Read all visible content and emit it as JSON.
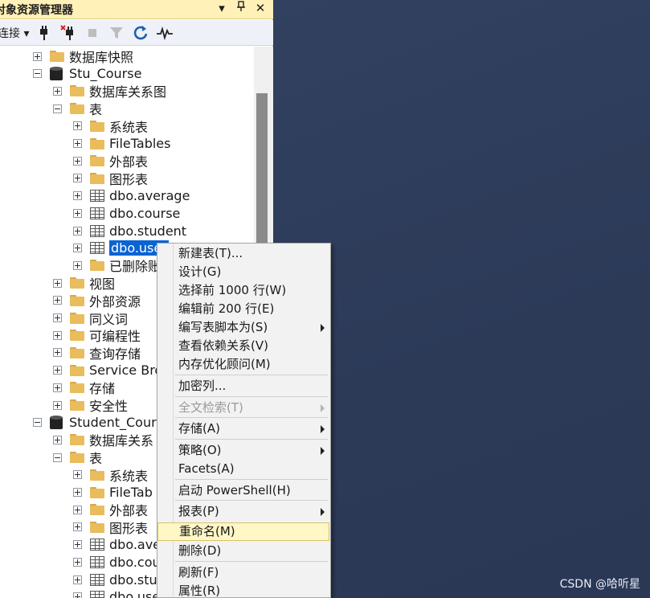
{
  "panel": {
    "title": "对象资源管理器",
    "pin_glyph": "▾",
    "pin2_glyph": "📌",
    "close_glyph": "✕"
  },
  "toolbar": {
    "connect_label": "连接 ▾"
  },
  "tree": [
    {
      "label": "数据库快照",
      "icon": "folder-icon",
      "expander": "plus"
    },
    {
      "label": "Stu_Course",
      "icon": "database-icon",
      "expander": "minus"
    },
    {
      "label": "数据库关系图",
      "icon": "folder-icon",
      "expander": "plus"
    },
    {
      "label": "表",
      "icon": "folder-icon",
      "expander": "minus"
    },
    {
      "label": "系统表",
      "icon": "folder-icon",
      "expander": "plus"
    },
    {
      "label": "FileTables",
      "icon": "folder-icon",
      "expander": "plus"
    },
    {
      "label": "外部表",
      "icon": "folder-icon",
      "expander": "plus"
    },
    {
      "label": "图形表",
      "icon": "folder-icon",
      "expander": "plus"
    },
    {
      "label": "dbo.average",
      "icon": "table-icon",
      "expander": "plus"
    },
    {
      "label": "dbo.course",
      "icon": "table-icon",
      "expander": "plus"
    },
    {
      "label": "dbo.student",
      "icon": "table-icon",
      "expander": "plus"
    },
    {
      "label": "dbo.user",
      "icon": "table-icon",
      "expander": "plus",
      "selected": true
    },
    {
      "label": "已删除账",
      "icon": "folder-icon",
      "expander": "plus"
    },
    {
      "label": "视图",
      "icon": "folder-icon",
      "expander": "plus"
    },
    {
      "label": "外部资源",
      "icon": "folder-icon",
      "expander": "plus"
    },
    {
      "label": "同义词",
      "icon": "folder-icon",
      "expander": "plus"
    },
    {
      "label": "可编程性",
      "icon": "folder-icon",
      "expander": "plus"
    },
    {
      "label": "查询存储",
      "icon": "folder-icon",
      "expander": "plus"
    },
    {
      "label": "Service Bro",
      "icon": "folder-icon",
      "expander": "plus"
    },
    {
      "label": "存储",
      "icon": "folder-icon",
      "expander": "plus"
    },
    {
      "label": "安全性",
      "icon": "folder-icon",
      "expander": "plus"
    },
    {
      "label": "Student_Cour",
      "icon": "database-icon",
      "expander": "minus"
    },
    {
      "label": "数据库关系",
      "icon": "folder-icon",
      "expander": "plus"
    },
    {
      "label": "表",
      "icon": "folder-icon",
      "expander": "minus"
    },
    {
      "label": "系统表",
      "icon": "folder-icon",
      "expander": "plus"
    },
    {
      "label": "FileTab",
      "icon": "folder-icon",
      "expander": "plus"
    },
    {
      "label": "外部表",
      "icon": "folder-icon",
      "expander": "plus"
    },
    {
      "label": "图形表",
      "icon": "folder-icon",
      "expander": "plus"
    },
    {
      "label": "dbo.ave",
      "icon": "table-icon",
      "expander": "plus"
    },
    {
      "label": "dbo.cou",
      "icon": "table-icon",
      "expander": "plus"
    },
    {
      "label": "dbo.stu",
      "icon": "table-icon",
      "expander": "plus"
    },
    {
      "label": "dbo.use",
      "icon": "table-icon",
      "expander": "plus"
    }
  ],
  "context_menu": {
    "items": [
      {
        "label": "新建表(T)..."
      },
      {
        "label": "设计(G)"
      },
      {
        "label": "选择前 1000 行(W)"
      },
      {
        "label": "编辑前 200 行(E)"
      },
      {
        "label": "编写表脚本为(S)",
        "submenu": true
      },
      {
        "label": "查看依赖关系(V)"
      },
      {
        "label": "内存优化顾问(M)"
      },
      {
        "label": "加密列..."
      },
      {
        "label": "全文检索(T)",
        "submenu": true,
        "disabled": true
      },
      {
        "label": "存储(A)",
        "submenu": true
      },
      {
        "label": "策略(O)",
        "submenu": true
      },
      {
        "label": "Facets(A)"
      },
      {
        "label": "启动 PowerShell(H)"
      },
      {
        "label": "报表(P)",
        "submenu": true
      },
      {
        "label": "重命名(M)",
        "hover": true
      },
      {
        "label": "删除(D)"
      },
      {
        "label": "刷新(F)"
      },
      {
        "label": "属性(R)"
      }
    ]
  },
  "watermark": "CSDN @哈听星"
}
